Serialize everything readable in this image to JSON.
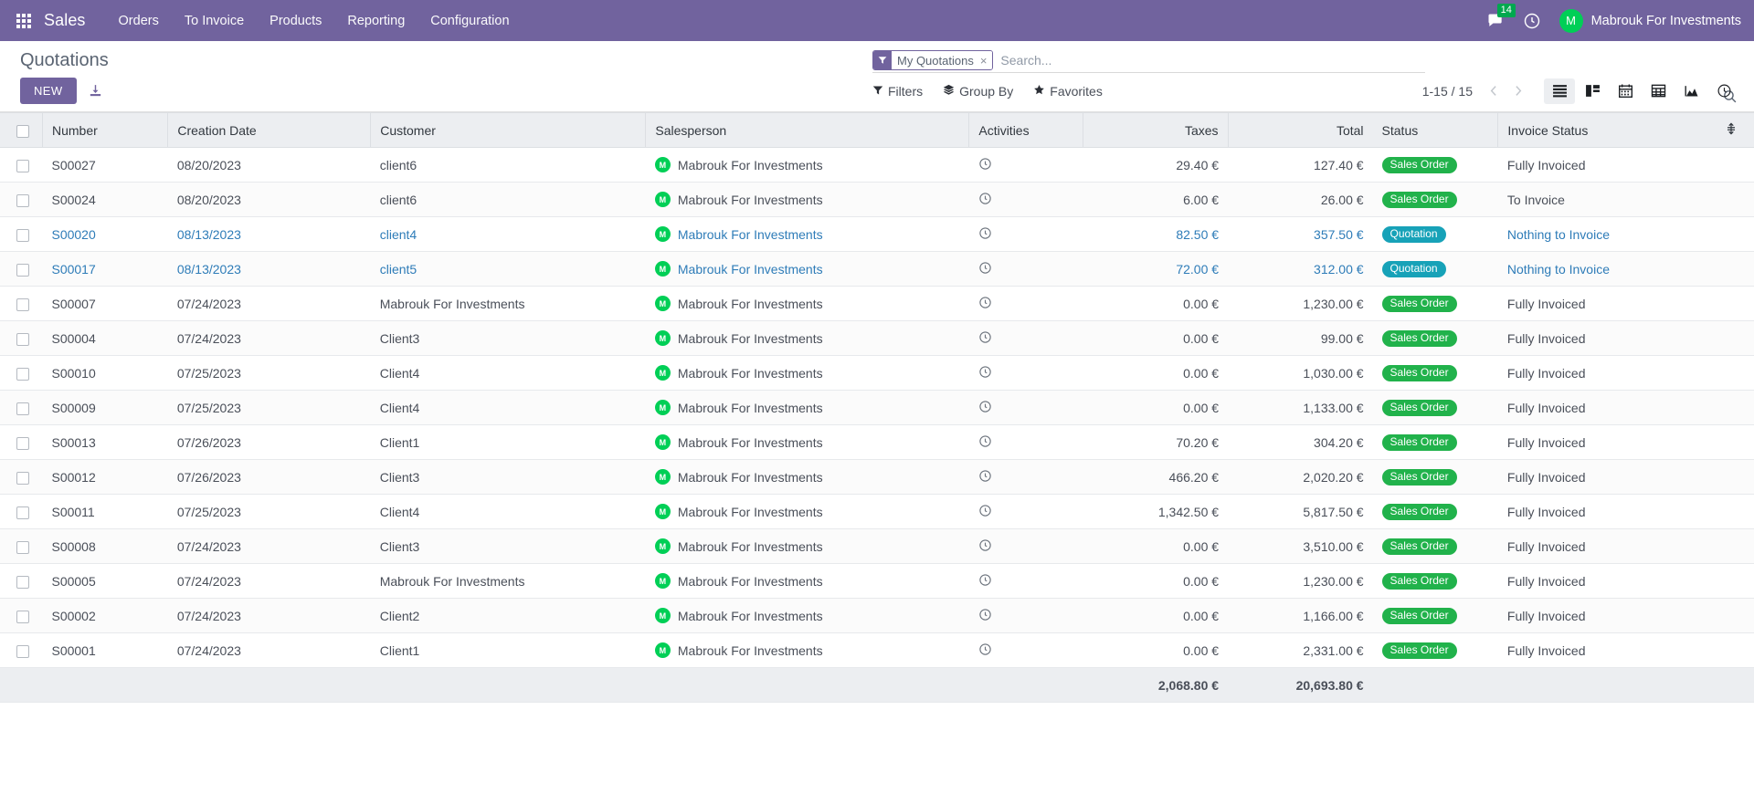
{
  "navbar": {
    "apps_icon": "apps-grid-icon",
    "brand": "Sales",
    "menu": [
      {
        "label": "Orders"
      },
      {
        "label": "To Invoice"
      },
      {
        "label": "Products"
      },
      {
        "label": "Reporting"
      },
      {
        "label": "Configuration"
      }
    ],
    "messages_icon": "chat-bubble-icon",
    "messages_count": "14",
    "activities_icon": "clock-icon",
    "user": {
      "initial": "M",
      "name": "Mabrouk For Investments"
    },
    "background_color": "#71639e"
  },
  "control_panel": {
    "title": "Quotations",
    "new_label": "NEW",
    "download_icon": "download-icon",
    "search": {
      "facet_icon": "filter-funnel-icon",
      "facet_label": "My Quotations",
      "facet_remove": "×",
      "placeholder": "Search...",
      "value": "",
      "magnifier_icon": "search-icon"
    },
    "menus": [
      {
        "label": "Filters",
        "icon": "filter-funnel-icon"
      },
      {
        "label": "Group By",
        "icon": "layers-icon"
      },
      {
        "label": "Favorites",
        "icon": "star-icon"
      }
    ],
    "pager": {
      "range": "1-15 / 15",
      "prev_icon": "chevron-left-icon",
      "next_icon": "chevron-right-icon"
    },
    "views": [
      {
        "name": "list-view",
        "icon": "list-icon",
        "active": true
      },
      {
        "name": "kanban-view",
        "icon": "kanban-icon",
        "active": false
      },
      {
        "name": "calendar-view",
        "icon": "calendar-icon",
        "active": false
      },
      {
        "name": "pivot-view",
        "icon": "pivot-table-icon",
        "active": false
      },
      {
        "name": "graph-view",
        "icon": "area-chart-icon",
        "active": false
      },
      {
        "name": "activity-view",
        "icon": "clock-icon",
        "active": false
      }
    ]
  },
  "table": {
    "columns": {
      "select_all": "select-all-checkbox",
      "number": "Number",
      "creation_date": "Creation Date",
      "customer": "Customer",
      "salesperson": "Salesperson",
      "activities": "Activities",
      "taxes": "Taxes",
      "total": "Total",
      "status": "Status",
      "invoice_status": "Invoice Status",
      "optional_icon": "column-options-icon"
    },
    "rows": [
      {
        "number": "S00027",
        "date": "08/20/2023",
        "customer": "client6",
        "salesperson": "Mabrouk For Investments",
        "avatar": "M",
        "taxes": "29.40 €",
        "total": "127.40 €",
        "status": "Sales Order",
        "status_type": "sale",
        "invoice_status": "Fully Invoiced",
        "highlight": false
      },
      {
        "number": "S00024",
        "date": "08/20/2023",
        "customer": "client6",
        "salesperson": "Mabrouk For Investments",
        "avatar": "M",
        "taxes": "6.00 €",
        "total": "26.00 €",
        "status": "Sales Order",
        "status_type": "sale",
        "invoice_status": "To Invoice",
        "highlight": false
      },
      {
        "number": "S00020",
        "date": "08/13/2023",
        "customer": "client4",
        "salesperson": "Mabrouk For Investments",
        "avatar": "M",
        "taxes": "82.50 €",
        "total": "357.50 €",
        "status": "Quotation",
        "status_type": "quote",
        "invoice_status": "Nothing to Invoice",
        "highlight": true
      },
      {
        "number": "S00017",
        "date": "08/13/2023",
        "customer": "client5",
        "salesperson": "Mabrouk For Investments",
        "avatar": "M",
        "taxes": "72.00 €",
        "total": "312.00 €",
        "status": "Quotation",
        "status_type": "quote",
        "invoice_status": "Nothing to Invoice",
        "highlight": true
      },
      {
        "number": "S00007",
        "date": "07/24/2023",
        "customer": "Mabrouk For Investments",
        "salesperson": "Mabrouk For Investments",
        "avatar": "M",
        "taxes": "0.00 €",
        "total": "1,230.00 €",
        "status": "Sales Order",
        "status_type": "sale",
        "invoice_status": "Fully Invoiced",
        "highlight": false
      },
      {
        "number": "S00004",
        "date": "07/24/2023",
        "customer": "Client3",
        "salesperson": "Mabrouk For Investments",
        "avatar": "M",
        "taxes": "0.00 €",
        "total": "99.00 €",
        "status": "Sales Order",
        "status_type": "sale",
        "invoice_status": "Fully Invoiced",
        "highlight": false
      },
      {
        "number": "S00010",
        "date": "07/25/2023",
        "customer": "Client4",
        "salesperson": "Mabrouk For Investments",
        "avatar": "M",
        "taxes": "0.00 €",
        "total": "1,030.00 €",
        "status": "Sales Order",
        "status_type": "sale",
        "invoice_status": "Fully Invoiced",
        "highlight": false
      },
      {
        "number": "S00009",
        "date": "07/25/2023",
        "customer": "Client4",
        "salesperson": "Mabrouk For Investments",
        "avatar": "M",
        "taxes": "0.00 €",
        "total": "1,133.00 €",
        "status": "Sales Order",
        "status_type": "sale",
        "invoice_status": "Fully Invoiced",
        "highlight": false
      },
      {
        "number": "S00013",
        "date": "07/26/2023",
        "customer": "Client1",
        "salesperson": "Mabrouk For Investments",
        "avatar": "M",
        "taxes": "70.20 €",
        "total": "304.20 €",
        "status": "Sales Order",
        "status_type": "sale",
        "invoice_status": "Fully Invoiced",
        "highlight": false
      },
      {
        "number": "S00012",
        "date": "07/26/2023",
        "customer": "Client3",
        "salesperson": "Mabrouk For Investments",
        "avatar": "M",
        "taxes": "466.20 €",
        "total": "2,020.20 €",
        "status": "Sales Order",
        "status_type": "sale",
        "invoice_status": "Fully Invoiced",
        "highlight": false
      },
      {
        "number": "S00011",
        "date": "07/25/2023",
        "customer": "Client4",
        "salesperson": "Mabrouk For Investments",
        "avatar": "M",
        "taxes": "1,342.50 €",
        "total": "5,817.50 €",
        "status": "Sales Order",
        "status_type": "sale",
        "invoice_status": "Fully Invoiced",
        "highlight": false
      },
      {
        "number": "S00008",
        "date": "07/24/2023",
        "customer": "Client3",
        "salesperson": "Mabrouk For Investments",
        "avatar": "M",
        "taxes": "0.00 €",
        "total": "3,510.00 €",
        "status": "Sales Order",
        "status_type": "sale",
        "invoice_status": "Fully Invoiced",
        "highlight": false
      },
      {
        "number": "S00005",
        "date": "07/24/2023",
        "customer": "Mabrouk For Investments",
        "salesperson": "Mabrouk For Investments",
        "avatar": "M",
        "taxes": "0.00 €",
        "total": "1,230.00 €",
        "status": "Sales Order",
        "status_type": "sale",
        "invoice_status": "Fully Invoiced",
        "highlight": false
      },
      {
        "number": "S00002",
        "date": "07/24/2023",
        "customer": "Client2",
        "salesperson": "Mabrouk For Investments",
        "avatar": "M",
        "taxes": "0.00 €",
        "total": "1,166.00 €",
        "status": "Sales Order",
        "status_type": "sale",
        "invoice_status": "Fully Invoiced",
        "highlight": false
      },
      {
        "number": "S00001",
        "date": "07/24/2023",
        "customer": "Client1",
        "salesperson": "Mabrouk For Investments",
        "avatar": "M",
        "taxes": "0.00 €",
        "total": "2,331.00 €",
        "status": "Sales Order",
        "status_type": "sale",
        "invoice_status": "Fully Invoiced",
        "highlight": false
      }
    ],
    "totals": {
      "taxes": "2,068.80 €",
      "total": "20,693.80 €"
    }
  },
  "colors": {
    "brand_purple": "#71639e",
    "badge_sale_green": "#21b24b",
    "badge_quote_cyan": "#17a2b8",
    "avatar_green": "#00cf56",
    "link_blue": "#2e7cb8"
  }
}
